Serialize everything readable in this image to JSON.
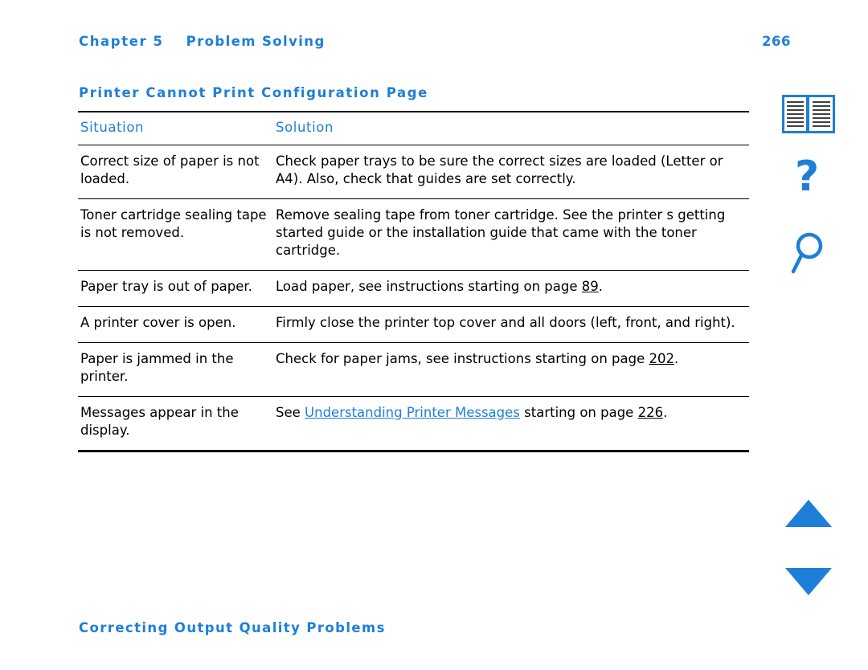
{
  "header": {
    "chapter_label": "Chapter 5",
    "chapter_title": "Problem Solving",
    "page_number": "266"
  },
  "section": {
    "heading": "Printer Cannot Print Configuration Page"
  },
  "table": {
    "columns": [
      "Situation",
      "Solution"
    ],
    "rows": [
      {
        "situation": "Correct size of paper is not loaded.",
        "solution_text": "Check paper trays to be sure the correct sizes are loaded (Letter or A4). Also, check that guides are set correctly."
      },
      {
        "situation": "Toner cartridge sealing tape is not removed.",
        "solution_text": "Remove sealing tape from toner cartridge. See the printer s getting started guide or the installation guide that came with the toner cartridge."
      },
      {
        "situation": "Paper tray is out of paper.",
        "solution_prefix": "Load paper, see instructions starting on page ",
        "solution_link": "89",
        "solution_suffix": "."
      },
      {
        "situation": "A printer cover is open.",
        "solution_text": "Firmly close the printer top cover and all doors (left, front, and right)."
      },
      {
        "situation": "Paper is jammed in the printer.",
        "solution_prefix": "Check for paper jams, see instructions starting on page ",
        "solution_link": "202",
        "solution_suffix": "."
      },
      {
        "situation": "Messages appear in the display.",
        "solution_prefix": "See ",
        "solution_bluelink": "Understanding Printer Messages",
        "solution_mid": " starting on page ",
        "solution_link": "226",
        "solution_suffix": "."
      }
    ]
  },
  "footer": {
    "heading": "Correcting Output Quality Problems"
  },
  "rail": {
    "icons": [
      {
        "name": "book-icon",
        "label": "Contents"
      },
      {
        "name": "question-mark-icon",
        "label": "Help"
      },
      {
        "name": "magnifier-icon",
        "label": "Search"
      },
      {
        "name": "triangle-up-icon",
        "label": "Previous page"
      },
      {
        "name": "triangle-down-icon",
        "label": "Next page"
      }
    ]
  },
  "colors": {
    "accent_blue": "#1d7fd7",
    "rule_black": "#000000",
    "page_background": "#ffffff"
  }
}
